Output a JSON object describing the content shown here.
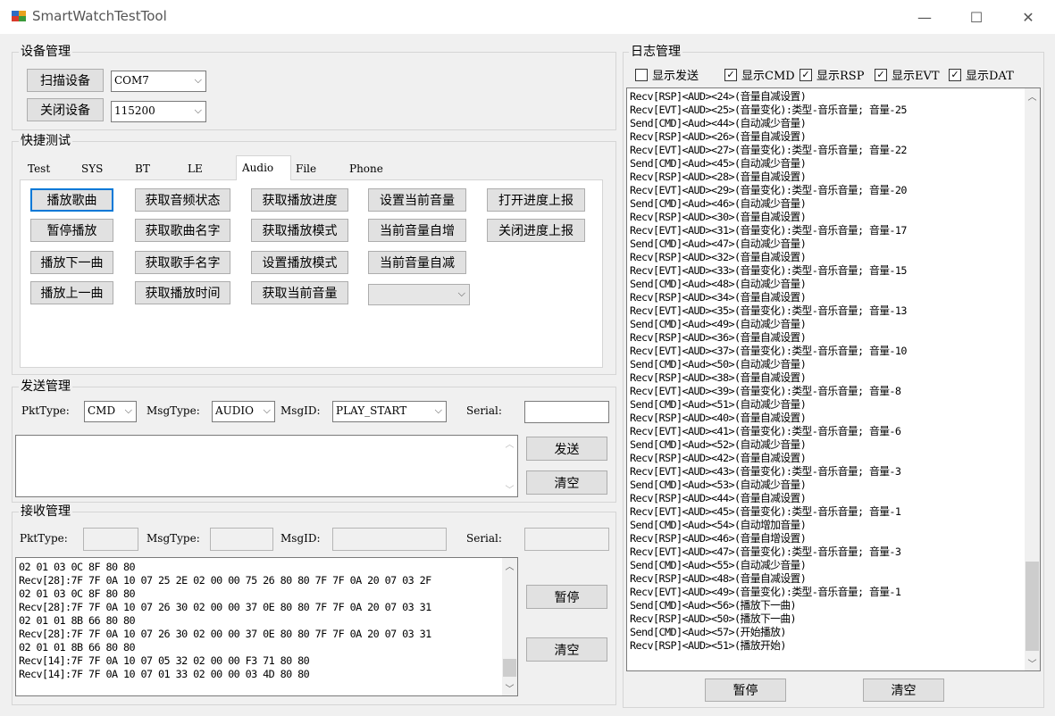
{
  "window": {
    "title": "SmartWatchTestTool",
    "min": "—",
    "max": "☐",
    "close": "✕"
  },
  "device": {
    "title": "设备管理",
    "scan_btn": "扫描设备",
    "close_btn": "关闭设备",
    "port": "COM7",
    "baud": "115200"
  },
  "quick": {
    "title": "快捷测试",
    "tabs": [
      "Test",
      "SYS",
      "BT",
      "LE",
      "Audio",
      "File",
      "Phone"
    ],
    "selected_tab": "Audio",
    "buttons": [
      [
        "播放歌曲",
        "获取音频状态",
        "获取播放进度",
        "设置当前音量",
        "打开进度上报"
      ],
      [
        "暂停播放",
        "获取歌曲名字",
        "获取播放模式",
        "当前音量自增",
        "关闭进度上报"
      ],
      [
        "播放下一曲",
        "获取歌手名字",
        "设置播放模式",
        "当前音量自减"
      ],
      [
        "播放上一曲",
        "获取播放时间",
        "获取当前音量"
      ]
    ],
    "mode_select": ""
  },
  "send": {
    "title": "发送管理",
    "pkt_label": "PktType:",
    "pkt_value": "CMD",
    "msgtype_label": "MsgType:",
    "msgtype_value": "AUDIO",
    "msgid_label": "MsgID:",
    "msgid_value": "PLAY_START",
    "serial_label": "Serial:",
    "serial_value": "",
    "payload": "",
    "send_btn": "发送",
    "clear_btn": "清空"
  },
  "recv": {
    "title": "接收管理",
    "pkt_label": "PktType:",
    "msgtype_label": "MsgType:",
    "msgid_label": "MsgID:",
    "serial_label": "Serial:",
    "pkt_value": "",
    "msgtype_value": "",
    "msgid_value": "",
    "serial_value": "",
    "lines": [
      "02 01 03 0C 8F 80 80",
      "Recv[28]:7F 7F 0A 10 07 25 2E 02 00 00 75 26 80 80 7F 7F 0A 20 07 03 2F",
      "02 01 03 0C 8F 80 80",
      "Recv[28]:7F 7F 0A 10 07 26 30 02 00 00 37 0E 80 80 7F 7F 0A 20 07 03 31",
      "02 01 01 8B 66 80 80",
      "Recv[28]:7F 7F 0A 10 07 26 30 02 00 00 37 0E 80 80 7F 7F 0A 20 07 03 31",
      "02 01 01 8B 66 80 80",
      "Recv[14]:7F 7F 0A 10 07 05 32 02 00 00 F3 71 80 80",
      "Recv[14]:7F 7F 0A 10 07 01 33 02 00 00 03 4D 80 80"
    ],
    "pause_btn": "暂停",
    "clear_btn": "清空"
  },
  "log": {
    "title": "日志管理",
    "filters": [
      {
        "label": "显示发送",
        "checked": false
      },
      {
        "label": "显示CMD",
        "checked": true
      },
      {
        "label": "显示RSP",
        "checked": true
      },
      {
        "label": "显示EVT",
        "checked": true
      },
      {
        "label": "显示DAT",
        "checked": true
      }
    ],
    "lines": [
      "Recv[RSP]<AUD><24>(音量自减设置)",
      "Recv[EVT]<AUD><25>(音量变化):类型-音乐音量; 音量-25",
      "Send[CMD]<Aud><44>(自动减少音量)",
      "Recv[RSP]<AUD><26>(音量自减设置)",
      "Recv[EVT]<AUD><27>(音量变化):类型-音乐音量; 音量-22",
      "Send[CMD]<Aud><45>(自动减少音量)",
      "Recv[RSP]<AUD><28>(音量自减设置)",
      "Recv[EVT]<AUD><29>(音量变化):类型-音乐音量; 音量-20",
      "Send[CMD]<Aud><46>(自动减少音量)",
      "Recv[RSP]<AUD><30>(音量自减设置)",
      "Recv[EVT]<AUD><31>(音量变化):类型-音乐音量; 音量-17",
      "Send[CMD]<Aud><47>(自动减少音量)",
      "Recv[RSP]<AUD><32>(音量自减设置)",
      "Recv[EVT]<AUD><33>(音量变化):类型-音乐音量; 音量-15",
      "Send[CMD]<Aud><48>(自动减少音量)",
      "Recv[RSP]<AUD><34>(音量自减设置)",
      "Recv[EVT]<AUD><35>(音量变化):类型-音乐音量; 音量-13",
      "Send[CMD]<Aud><49>(自动减少音量)",
      "Recv[RSP]<AUD><36>(音量自减设置)",
      "Recv[EVT]<AUD><37>(音量变化):类型-音乐音量; 音量-10",
      "Send[CMD]<Aud><50>(自动减少音量)",
      "Recv[RSP]<AUD><38>(音量自减设置)",
      "Recv[EVT]<AUD><39>(音量变化):类型-音乐音量; 音量-8",
      "Send[CMD]<Aud><51>(自动减少音量)",
      "Recv[RSP]<AUD><40>(音量自减设置)",
      "Recv[EVT]<AUD><41>(音量变化):类型-音乐音量; 音量-6",
      "Send[CMD]<Aud><52>(自动减少音量)",
      "Recv[RSP]<AUD><42>(音量自减设置)",
      "Recv[EVT]<AUD><43>(音量变化):类型-音乐音量; 音量-3",
      "Send[CMD]<Aud><53>(自动减少音量)",
      "Recv[RSP]<AUD><44>(音量自减设置)",
      "Recv[EVT]<AUD><45>(音量变化):类型-音乐音量; 音量-1",
      "Send[CMD]<Aud><54>(自动增加音量)",
      "Recv[RSP]<AUD><46>(音量自增设置)",
      "Recv[EVT]<AUD><47>(音量变化):类型-音乐音量; 音量-3",
      "Send[CMD]<Aud><55>(自动减少音量)",
      "Recv[RSP]<AUD><48>(音量自减设置)",
      "Recv[EVT]<AUD><49>(音量变化):类型-音乐音量; 音量-1",
      "Send[CMD]<Aud><56>(播放下一曲)",
      "Recv[RSP]<AUD><50>(播放下一曲)",
      "Send[CMD]<Aud><57>(开始播放)",
      "Recv[RSP]<AUD><51>(播放开始)"
    ],
    "pause_btn": "暂停",
    "clear_btn": "清空"
  },
  "icons": {
    "app": "app-window-icon",
    "dropdown": "chevron-down-icon",
    "check": "check-icon"
  }
}
